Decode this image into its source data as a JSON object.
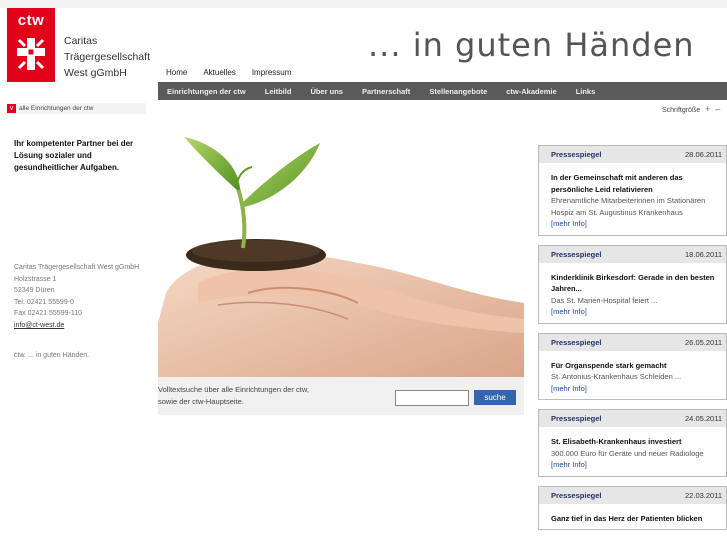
{
  "brand": {
    "logo_text": "ctw",
    "org_lines": [
      "Caritas",
      "Trägergesellschaft",
      "West gGmbH"
    ],
    "accent": "#e2001a"
  },
  "slogan": "... in guten Händen",
  "topnav": [
    "Home",
    "Aktuelles",
    "Impressum"
  ],
  "mainnav": [
    "Einrichtungen der ctw",
    "Leitbild",
    "Über uns",
    "Partnerschaft",
    "Stellenangebote",
    "ctw-Akademie",
    "Links"
  ],
  "einrichtungen_select": "alle Einrichtungen der ctw",
  "fontsize": {
    "label": "Schriftgröße",
    "plus": "+",
    "minus": "–"
  },
  "intro": "Ihr kompetenter Partner bei der Lösung sozialer und gesundheitlicher Aufgaben.",
  "address": {
    "lines": [
      "Caritas Trägergesellschaft West gGmbH",
      "Holzstrasse 1",
      "52349 Düren",
      "Tel. 02421 55599-0",
      "Fax 02421 55599-110"
    ],
    "email": "info@ct-west.de"
  },
  "claim": "ctw. ... in guten Händen.",
  "search": {
    "text_lines": [
      "Volltextsuche über alle Einrichtungen der ctw,",
      "sowie der ctw-Hauptseite."
    ],
    "button": "suche",
    "value": ""
  },
  "press": [
    {
      "label": "Pressespiegel",
      "date": "28.06.2011",
      "title": "In der Gemeinschaft mit anderen das persönliche Leid relativieren",
      "sub": "Ehrenamtliche Mitarbeiterinnen im Stationären Hospiz am St. Augustinus Krankenhaus",
      "more": "[mehr Info]"
    },
    {
      "label": "Pressespiegel",
      "date": "18.06.2011",
      "title": "Kinderklinik Birkesdorf: Gerade in den besten Jahren...",
      "sub": "Das St. Marien-Hospital feiert ...",
      "more": "[mehr Info]"
    },
    {
      "label": "Pressespiegel",
      "date": "26.05.2011",
      "title": "Für Organspende stark gemacht",
      "sub": "St. Antonius-Krankenhaus Schleiden ...",
      "more": "[mehr Info]"
    },
    {
      "label": "Pressespiegel",
      "date": "24.05.2011",
      "title": "St. Elisabeth-Krankenhaus investiert",
      "sub": "300.000 Euro für Geräte und neuer Radiologe",
      "more": "[mehr Info]"
    },
    {
      "label": "Pressespiegel",
      "date": "22.03.2011",
      "title": "Ganz tief in das Herz der Patienten blicken",
      "sub": "",
      "more": ""
    }
  ]
}
